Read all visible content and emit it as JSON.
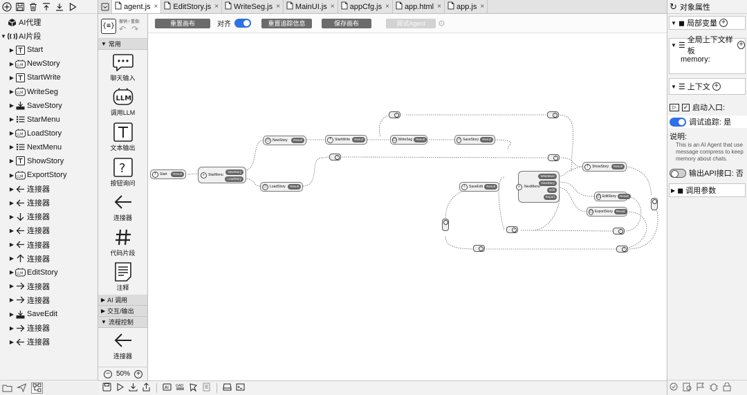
{
  "left_panel": {
    "tree": [
      {
        "label": "AI代理",
        "twisty": "",
        "icon": "cube-icon",
        "indent": 0
      },
      {
        "label": "AI片段",
        "twisty": "▼",
        "icon": "segment-icon",
        "indent": 0
      },
      {
        "label": "Start",
        "twisty": "▶",
        "icon": "text-t-icon",
        "indent": 1
      },
      {
        "label": "NewStory",
        "twisty": "▶",
        "icon": "llm-icon",
        "indent": 1
      },
      {
        "label": "StartWrite",
        "twisty": "▶",
        "icon": "text-t-icon",
        "indent": 1
      },
      {
        "label": "WriteSeg",
        "twisty": "▶",
        "icon": "llm-icon",
        "indent": 1
      },
      {
        "label": "SaveStory",
        "twisty": "▶",
        "icon": "save-icon",
        "indent": 1
      },
      {
        "label": "StarMenu",
        "twisty": "▶",
        "icon": "menu-list-icon",
        "indent": 1
      },
      {
        "label": "LoadStory",
        "twisty": "▶",
        "icon": "llm-icon",
        "indent": 1
      },
      {
        "label": "NextMenu",
        "twisty": "▶",
        "icon": "menu-list-icon",
        "indent": 1
      },
      {
        "label": "ShowStory",
        "twisty": "▶",
        "icon": "text-t-icon",
        "indent": 1
      },
      {
        "label": "ExportStory",
        "twisty": "▶",
        "icon": "llm-icon",
        "indent": 1
      },
      {
        "label": "连接器",
        "twisty": "▶",
        "icon": "arrow-left-icon",
        "indent": 1
      },
      {
        "label": "连接器",
        "twisty": "▶",
        "icon": "arrow-left-icon",
        "indent": 1
      },
      {
        "label": "连接器",
        "twisty": "▶",
        "icon": "arrow-down-icon",
        "indent": 1
      },
      {
        "label": "连接器",
        "twisty": "▶",
        "icon": "arrow-left-icon",
        "indent": 1
      },
      {
        "label": "连接器",
        "twisty": "▶",
        "icon": "arrow-left-icon",
        "indent": 1
      },
      {
        "label": "连接器",
        "twisty": "▶",
        "icon": "arrow-up-icon",
        "indent": 1
      },
      {
        "label": "EditStory",
        "twisty": "▶",
        "icon": "llm-icon",
        "indent": 1
      },
      {
        "label": "连接器",
        "twisty": "▶",
        "icon": "arrow-right-icon",
        "indent": 1
      },
      {
        "label": "连接器",
        "twisty": "▶",
        "icon": "arrow-right-icon",
        "indent": 1
      },
      {
        "label": "SaveEdit",
        "twisty": "▶",
        "icon": "save-icon",
        "indent": 1
      },
      {
        "label": "连接器",
        "twisty": "▶",
        "icon": "arrow-right-icon",
        "indent": 1
      },
      {
        "label": "连接器",
        "twisty": "▶",
        "icon": "arrow-left-icon",
        "indent": 1
      }
    ]
  },
  "tabs": [
    {
      "label": "agent.js",
      "active": true
    },
    {
      "label": "EditStory.js",
      "active": false
    },
    {
      "label": "WriteSeg.js",
      "active": false
    },
    {
      "label": "MainUI.js",
      "active": false
    },
    {
      "label": "appCfg.js",
      "active": false
    },
    {
      "label": "app.html",
      "active": false
    },
    {
      "label": "app.js",
      "active": false
    }
  ],
  "tab_close": "×",
  "palette": {
    "undo_label": "撤销 / 重做:",
    "sections": {
      "common": "常用",
      "ai_call": "AI 调用",
      "interaction": "交互/输出",
      "flow_control": "流程控制"
    },
    "items": [
      {
        "label": "聊天输入",
        "icon": "chat-bubble-icon"
      },
      {
        "label": "调用LLM",
        "icon": "llm-icon"
      },
      {
        "label": "文本输出",
        "icon": "text-t-icon"
      },
      {
        "label": "按钮询问",
        "icon": "question-icon"
      },
      {
        "label": "连接器",
        "icon": "arrow-left-icon"
      },
      {
        "label": "代码片段",
        "icon": "hash-icon"
      },
      {
        "label": "注释",
        "icon": "note-icon"
      }
    ],
    "flow_item": {
      "label": "连接器",
      "icon": "arrow-left-icon"
    },
    "zoom": "50%"
  },
  "toolbar": {
    "reset_canvas": "重置画布",
    "align_label": "对齐",
    "reset_trace": "重置追踪信息",
    "save_canvas": "保存画布",
    "debug_agent": "调试Agent"
  },
  "canvas": {
    "nodes": {
      "start": {
        "label": "Start",
        "port": "Result"
      },
      "starmenu": {
        "label": "StarMenu",
        "ports": [
          "NewStory",
          "LoadStory"
        ]
      },
      "newstory": {
        "label": "NewStory",
        "port": "Result"
      },
      "loadstory": {
        "label": "LoadStory",
        "port": "Result"
      },
      "startwrite": {
        "label": "StartWrite",
        "port": "Result"
      },
      "writeseg": {
        "label": "WriteSeg",
        "port": "Result"
      },
      "savestory": {
        "label": "SaveStory",
        "port": "Result"
      },
      "saveedit": {
        "label": "SaveEdit",
        "port": "Result"
      },
      "nextmenu": {
        "label": "NextMenu",
        "ports": [
          "WriteMore",
          "ViewStory",
          "Edit",
          "Export"
        ]
      },
      "showstory": {
        "label": "ShowStory",
        "port": "Result"
      },
      "editstory": {
        "label": "EditStory",
        "port": "Result"
      },
      "exportstory": {
        "label": "ExportStory",
        "port": "Result"
      }
    }
  },
  "right_panel": {
    "title": "对象属性",
    "local_vars": "局部变量",
    "global_context": "全局上下文样板",
    "memory_label": "memory:",
    "context": "上下文",
    "entry_label": "启动入口:",
    "trace_label": "调试追踪: 是",
    "desc_label": "说明:",
    "desc_text": "This is an AI Agent that use message compress to keep memory about chats.",
    "api_label": "输出API接口: 否",
    "call_params": "调用参数"
  },
  "colors": {
    "accent": "#2f6fe8",
    "button": "#6b6b6b",
    "panel_bg": "#f2f2f2"
  }
}
